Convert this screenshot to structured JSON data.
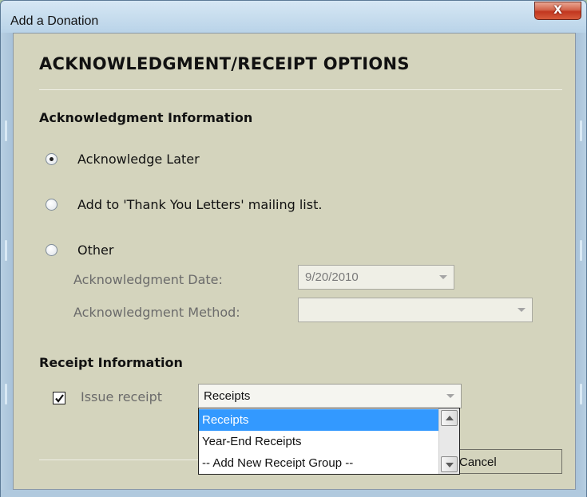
{
  "window": {
    "title": "Add a Donation",
    "close_label": "X"
  },
  "heading": "ACKNOWLEDGMENT/RECEIPT OPTIONS",
  "ack_section": {
    "title": "Acknowledgment Information",
    "options": [
      {
        "label": "Acknowledge Later",
        "checked": true
      },
      {
        "label": "Add to 'Thank You Letters' mailing list.",
        "checked": false
      },
      {
        "label": "Other",
        "checked": false
      }
    ],
    "date_label": "Acknowledgment Date:",
    "date_value": "9/20/2010",
    "method_label": "Acknowledgment Method:",
    "method_value": ""
  },
  "receipt_section": {
    "title": "Receipt Information",
    "issue_receipt_label": "Issue receipt",
    "issue_receipt_checked": true,
    "selected_group": "Receipts",
    "dropdown_options": [
      "Receipts",
      "Year-End Receipts",
      "-- Add New Receipt Group --"
    ]
  },
  "buttons": {
    "cancel_label": "Cancel"
  },
  "colors": {
    "panel_bg": "#d4d4bd",
    "selection": "#3399ff",
    "close_button": "#c2361f"
  }
}
